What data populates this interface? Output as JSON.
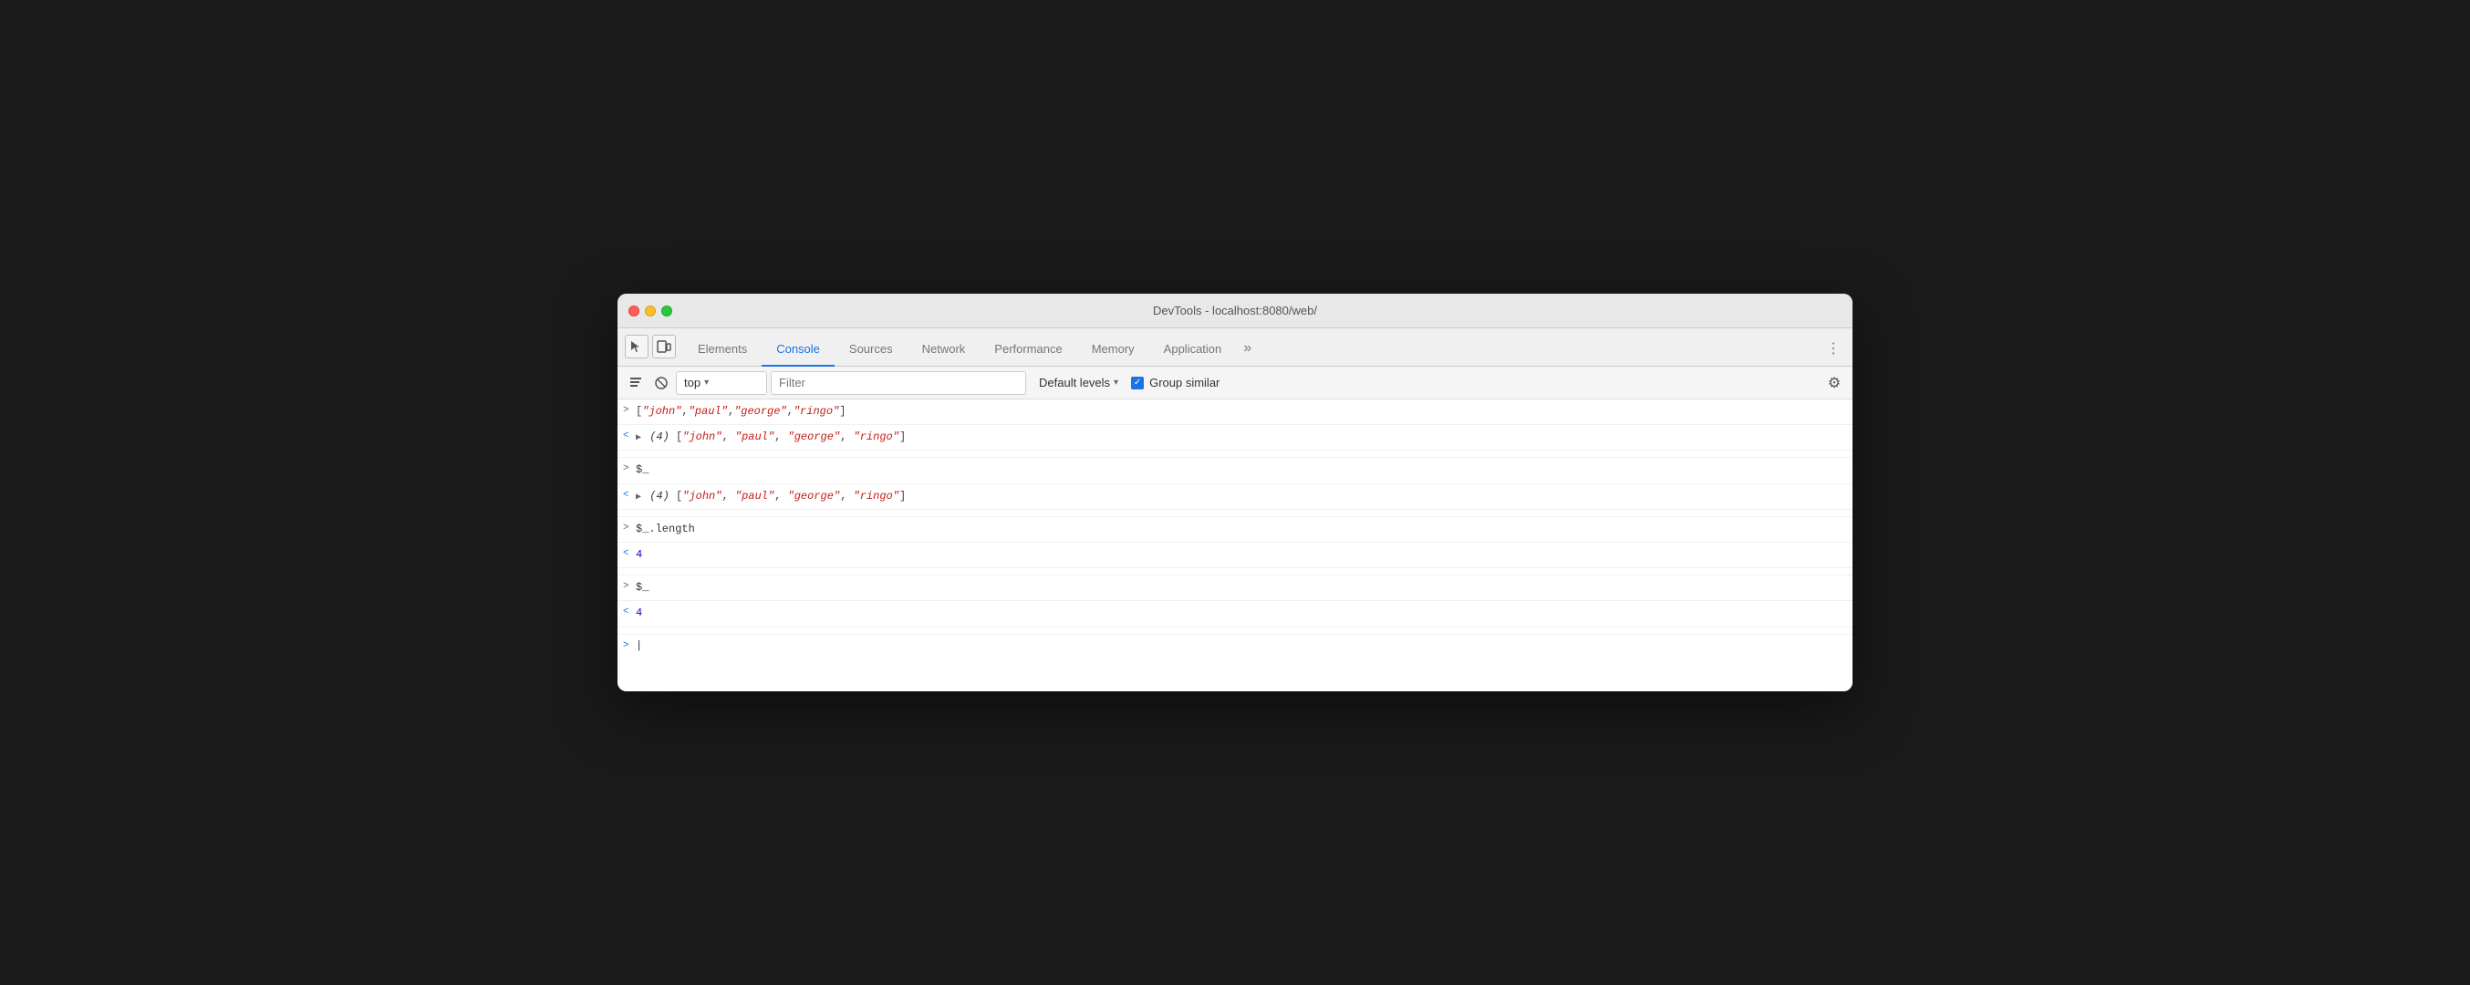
{
  "window": {
    "title": "DevTools - localhost:8080/web/"
  },
  "tabs": {
    "items": [
      {
        "id": "elements",
        "label": "Elements",
        "active": false
      },
      {
        "id": "console",
        "label": "Console",
        "active": true
      },
      {
        "id": "sources",
        "label": "Sources",
        "active": false
      },
      {
        "id": "network",
        "label": "Network",
        "active": false
      },
      {
        "id": "performance",
        "label": "Performance",
        "active": false
      },
      {
        "id": "memory",
        "label": "Memory",
        "active": false
      },
      {
        "id": "application",
        "label": "Application",
        "active": false
      }
    ]
  },
  "console_toolbar": {
    "context": "top",
    "context_arrow": "▾",
    "filter_placeholder": "Filter",
    "levels_label": "Default levels",
    "levels_arrow": "▾",
    "group_similar_label": "Group similar",
    "group_similar_checked": true
  },
  "console_rows": [
    {
      "type": "input",
      "arrow": ">",
      "content_raw": "[\"john\",\"paul\",\"george\",\"ringo\"]"
    },
    {
      "type": "output_array",
      "arrow": "<",
      "expandable": true,
      "count": 4,
      "items": [
        "john",
        "paul",
        "george",
        "ringo"
      ]
    },
    {
      "type": "divider"
    },
    {
      "type": "input",
      "arrow": ">",
      "content_raw": "$_"
    },
    {
      "type": "output_array",
      "arrow": "<",
      "expandable": true,
      "count": 4,
      "items": [
        "john",
        "paul",
        "george",
        "ringo"
      ]
    },
    {
      "type": "divider"
    },
    {
      "type": "input",
      "arrow": ">",
      "content_raw": "$_.length"
    },
    {
      "type": "output_number",
      "arrow": "<",
      "value": "4"
    },
    {
      "type": "divider"
    },
    {
      "type": "input",
      "arrow": ">",
      "content_raw": "$_"
    },
    {
      "type": "output_number",
      "arrow": "<",
      "value": "4"
    },
    {
      "type": "divider"
    }
  ],
  "icons": {
    "cursor": "⬡",
    "layers": "⧉",
    "block": "⊘",
    "chevron_down": "▾",
    "more": "»",
    "three_dots": "⋮",
    "gear": "⚙",
    "checkmark": "✓",
    "expand_right": "▶",
    "prompt_gt": ">"
  }
}
